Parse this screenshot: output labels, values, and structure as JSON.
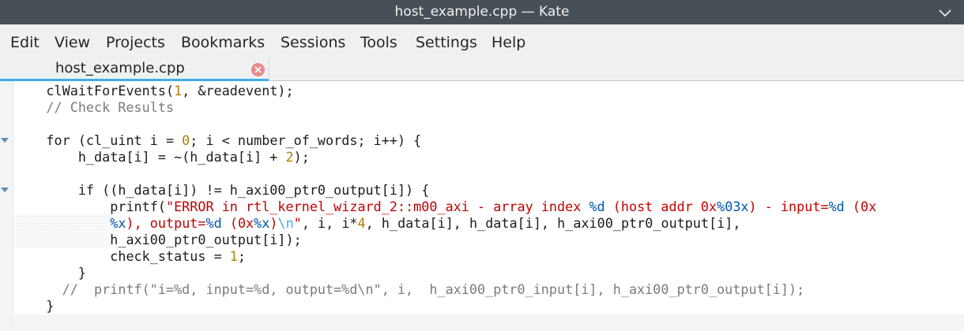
{
  "window": {
    "title": "host_example.cpp — Kate"
  },
  "menu": [
    "Edit",
    "View",
    "Projects",
    "Bookmarks",
    "Sessions",
    "Tools",
    "Settings",
    "Help"
  ],
  "tab": {
    "label": "host_example.cpp"
  },
  "colors": {
    "accent": "#3daee9",
    "titlebar": "#475057",
    "string": "#bf0303",
    "number": "#b08000",
    "comment": "#7a7c7d",
    "format_spec": "#0057ae"
  },
  "code": {
    "lines": [
      [
        {
          "t": "    clWaitForEvents(",
          "c": ""
        },
        {
          "t": "1",
          "c": "num"
        },
        {
          "t": ", &readevent);",
          "c": ""
        }
      ],
      [
        {
          "t": "    // Check Results",
          "c": "com"
        }
      ],
      [
        {
          "t": "",
          "c": ""
        }
      ],
      [
        {
          "t": "    for (cl_uint i = ",
          "c": ""
        },
        {
          "t": "0",
          "c": "num"
        },
        {
          "t": "; i < number_of_words; i++) {",
          "c": ""
        }
      ],
      [
        {
          "t": "        h_data[i] = ~(h_data[i] + ",
          "c": ""
        },
        {
          "t": "2",
          "c": "num"
        },
        {
          "t": ");",
          "c": ""
        }
      ],
      [
        {
          "t": "",
          "c": ""
        }
      ],
      [
        {
          "t": "        if ((h_data[i]) != h_axi00_ptr0_output[i]) {",
          "c": ""
        }
      ],
      [
        {
          "t": "            printf(",
          "c": ""
        },
        {
          "t": "\"ERROR in rtl_kernel_wizard_2::m00_axi - array index ",
          "c": "str"
        },
        {
          "t": "%d",
          "c": "fmt"
        },
        {
          "t": " (host addr 0x",
          "c": "str"
        },
        {
          "t": "%03x",
          "c": "fmt"
        },
        {
          "t": ") - input=",
          "c": "str"
        },
        {
          "t": "%d",
          "c": "fmt"
        },
        {
          "t": " (0x",
          "c": "str"
        }
      ],
      [
        {
          "t": "            ",
          "c": ""
        },
        {
          "t": "%x",
          "c": "fmt"
        },
        {
          "t": "), output=",
          "c": "str"
        },
        {
          "t": "%d",
          "c": "fmt"
        },
        {
          "t": " (0x",
          "c": "str"
        },
        {
          "t": "%x",
          "c": "fmt"
        },
        {
          "t": ")",
          "c": "str"
        },
        {
          "t": "\\n",
          "c": "esc"
        },
        {
          "t": "\"",
          "c": "str"
        },
        {
          "t": ", i, i*",
          "c": ""
        },
        {
          "t": "4",
          "c": "num"
        },
        {
          "t": ", h_data[i], h_data[i], h_axi00_ptr0_output[i],",
          "c": ""
        }
      ],
      [
        {
          "t": "            h_axi00_ptr0_output[i]);",
          "c": ""
        }
      ],
      [
        {
          "t": "            check_status = ",
          "c": ""
        },
        {
          "t": "1",
          "c": "num"
        },
        {
          "t": ";",
          "c": ""
        }
      ],
      [
        {
          "t": "        }",
          "c": ""
        }
      ],
      [
        {
          "t": "      //  printf(\"i=%d, input=%d, output=%d\\n\", i,  h_axi00_ptr0_input[i], h_axi00_ptr0_output[i]);",
          "c": "com"
        }
      ],
      [
        {
          "t": "    }",
          "c": ""
        }
      ],
      [
        {
          "t": "",
          "c": ""
        }
      ]
    ]
  }
}
